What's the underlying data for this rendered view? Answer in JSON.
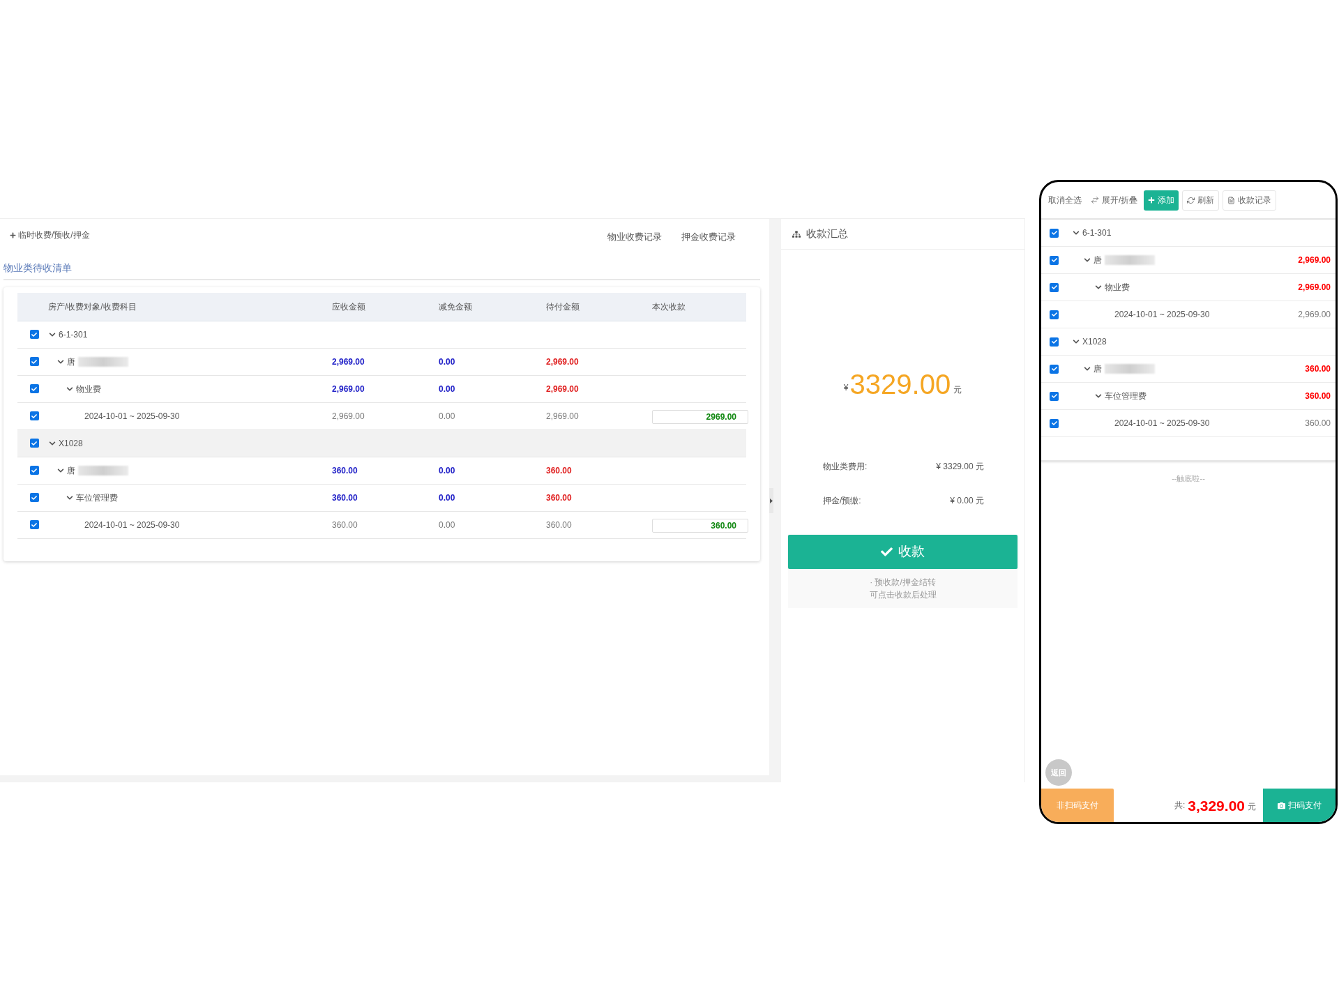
{
  "left_panel": {
    "add_link": "临时收费/预收/押金",
    "links": [
      "物业收费记录",
      "押金收费记录"
    ],
    "section_title": "物业类待收清单",
    "table": {
      "columns": [
        "房产/收费对象/收费科目",
        "应收金额",
        "减免金额",
        "待付金额",
        "本次收款"
      ],
      "rows": [
        {
          "kind": "property",
          "label": "6-1-301",
          "checked": true,
          "expanded": true,
          "highlighted": false,
          "children": [
            {
              "kind": "payer",
              "label": "唐",
              "blurred": true,
              "checked": true,
              "expanded": true,
              "highlighted": false,
              "receivable": "2,969.00",
              "waiver": "0.00",
              "pending": "2,969.00",
              "children": [
                {
                  "kind": "item",
                  "label": "物业费",
                  "checked": true,
                  "expanded": true,
                  "highlighted": false,
                  "receivable": "2,969.00",
                  "waiver": "0.00",
                  "pending": "2,969.00",
                  "children": [
                    {
                      "kind": "period",
                      "label": "2024-10-01 ~ 2025-09-30",
                      "checked": true,
                      "highlighted": false,
                      "receivable": "2,969.00",
                      "waiver": "0.00",
                      "pending": "2,969.00",
                      "payment": "2969.00"
                    }
                  ]
                }
              ]
            }
          ]
        },
        {
          "kind": "property",
          "label": "X1028",
          "checked": true,
          "expanded": true,
          "highlighted": true,
          "children": [
            {
              "kind": "payer",
              "label": "唐",
              "blurred": true,
              "checked": true,
              "expanded": true,
              "highlighted": false,
              "receivable": "360.00",
              "waiver": "0.00",
              "pending": "360.00",
              "children": [
                {
                  "kind": "item",
                  "label": "车位管理费",
                  "checked": true,
                  "expanded": true,
                  "highlighted": false,
                  "receivable": "360.00",
                  "waiver": "0.00",
                  "pending": "360.00",
                  "children": [
                    {
                      "kind": "period",
                      "label": "2024-10-01 ~ 2025-09-30",
                      "checked": true,
                      "highlighted": false,
                      "receivable": "360.00",
                      "waiver": "0.00",
                      "pending": "360.00",
                      "payment": "360.00"
                    }
                  ]
                }
              ]
            }
          ]
        }
      ]
    }
  },
  "summary_panel": {
    "title": "收款汇总",
    "currency": "¥",
    "total": "3329.00",
    "unit": "元",
    "lines": [
      {
        "label": "物业类费用:",
        "value": "¥ 3329.00 元"
      },
      {
        "label": "押金/预缴:",
        "value": "¥ 0.00 元"
      }
    ],
    "collect_button": "收款",
    "notes": [
      "· 预收款/押金结转",
      "可点击收款后处理"
    ]
  },
  "mobile": {
    "toolbar": [
      {
        "kind": "plain",
        "label": "取消全选"
      },
      {
        "kind": "toggle",
        "label": "展开/折叠"
      },
      {
        "kind": "add",
        "label": "添加"
      },
      {
        "kind": "refresh",
        "label": "刷新"
      },
      {
        "kind": "records",
        "label": "收款记录"
      }
    ],
    "rows": [
      {
        "kind": "property",
        "label": "6-1-301",
        "checked": true,
        "expanded": true,
        "children": [
          {
            "kind": "payer",
            "label": "唐",
            "blurred": true,
            "checked": true,
            "expanded": true,
            "amount": "2,969.00",
            "children": [
              {
                "kind": "item",
                "label": "物业费",
                "checked": true,
                "expanded": true,
                "amount": "2,969.00",
                "children": [
                  {
                    "kind": "period",
                    "label": "2024-10-01 ~ 2025-09-30",
                    "checked": true,
                    "amount": "2,969.00"
                  }
                ]
              }
            ]
          }
        ]
      },
      {
        "kind": "property",
        "label": "X1028",
        "checked": true,
        "expanded": true,
        "children": [
          {
            "kind": "payer",
            "label": "唐",
            "blurred": true,
            "checked": true,
            "expanded": true,
            "amount": "360.00",
            "children": [
              {
                "kind": "item",
                "label": "车位管理费",
                "checked": true,
                "expanded": true,
                "amount": "360.00",
                "children": [
                  {
                    "kind": "period",
                    "label": "2024-10-01 ~ 2025-09-30",
                    "checked": true,
                    "amount": "360.00"
                  }
                ]
              }
            ]
          }
        ]
      }
    ],
    "end_note": "--触底啦--",
    "back_button": "返回",
    "other_pay_button": "非扫码支付",
    "total_label": "共:",
    "total": "3,329.00",
    "total_unit": "元",
    "scan_pay_button": "扫码支付"
  }
}
